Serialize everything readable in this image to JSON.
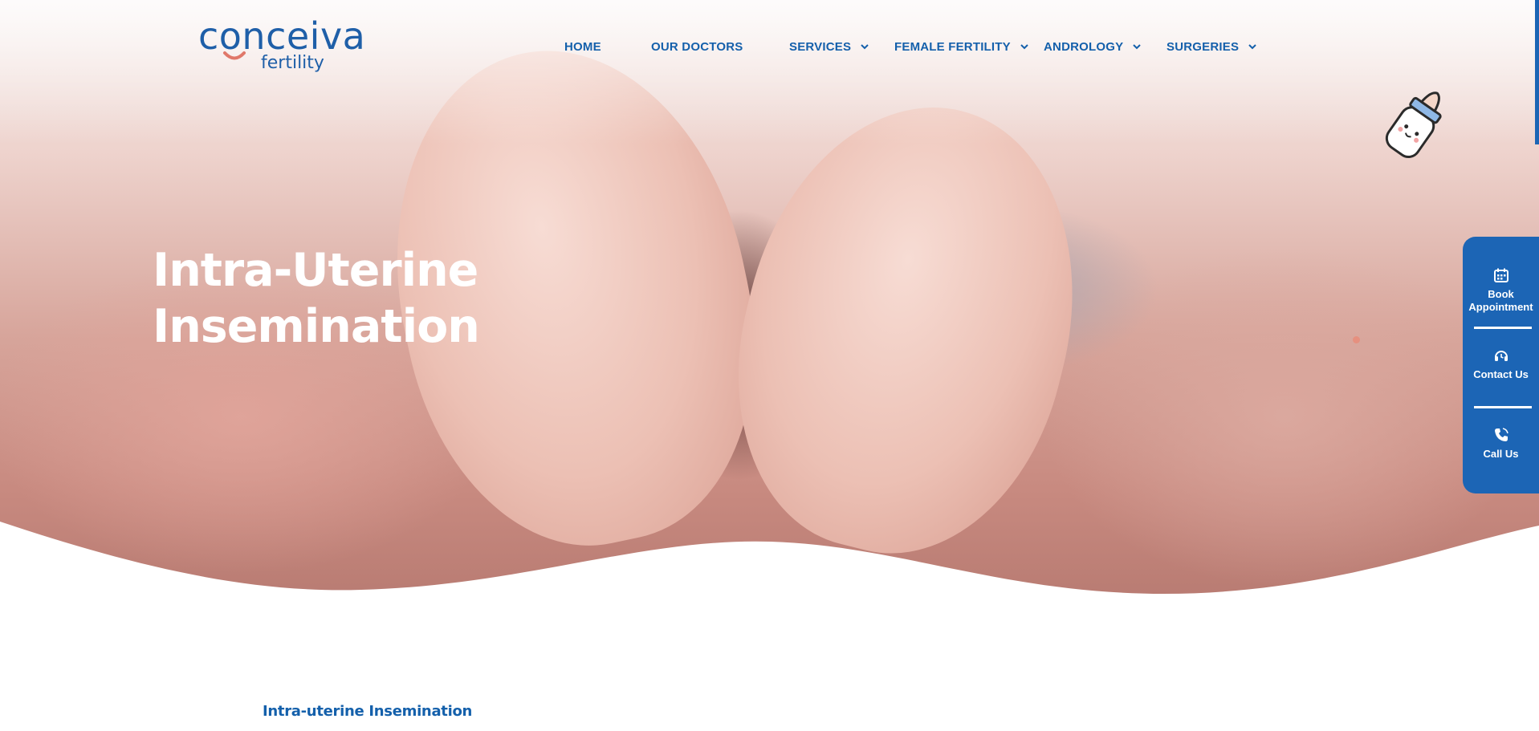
{
  "brand": {
    "name": "conceiva",
    "tagline": "fertility",
    "primary_color": "#1c65b5",
    "accent_color": "#e0786a"
  },
  "nav": {
    "items": [
      {
        "label": "HOME",
        "has_dropdown": false
      },
      {
        "label": "OUR DOCTORS",
        "has_dropdown": false
      },
      {
        "label": "SERVICES",
        "has_dropdown": true
      },
      {
        "label": "FEMALE FERTILITY",
        "has_dropdown": true
      },
      {
        "label": "ANDROLOGY",
        "has_dropdown": true
      },
      {
        "label": "SURGERIES",
        "has_dropdown": true
      }
    ],
    "dropdown_icon": "chevron-down-icon"
  },
  "hero": {
    "title_line1": "Intra-Uterine",
    "title_line2": "Insemination",
    "decor_icon": "baby-bottle-icon"
  },
  "side_widget": {
    "items": [
      {
        "label": "Book Appointment",
        "icon": "calendar-icon"
      },
      {
        "label": "Contact Us",
        "icon": "headset-icon"
      },
      {
        "label": "Call Us",
        "icon": "phone-icon"
      }
    ]
  },
  "content": {
    "section_title": "Intra-uterine Insemination"
  }
}
